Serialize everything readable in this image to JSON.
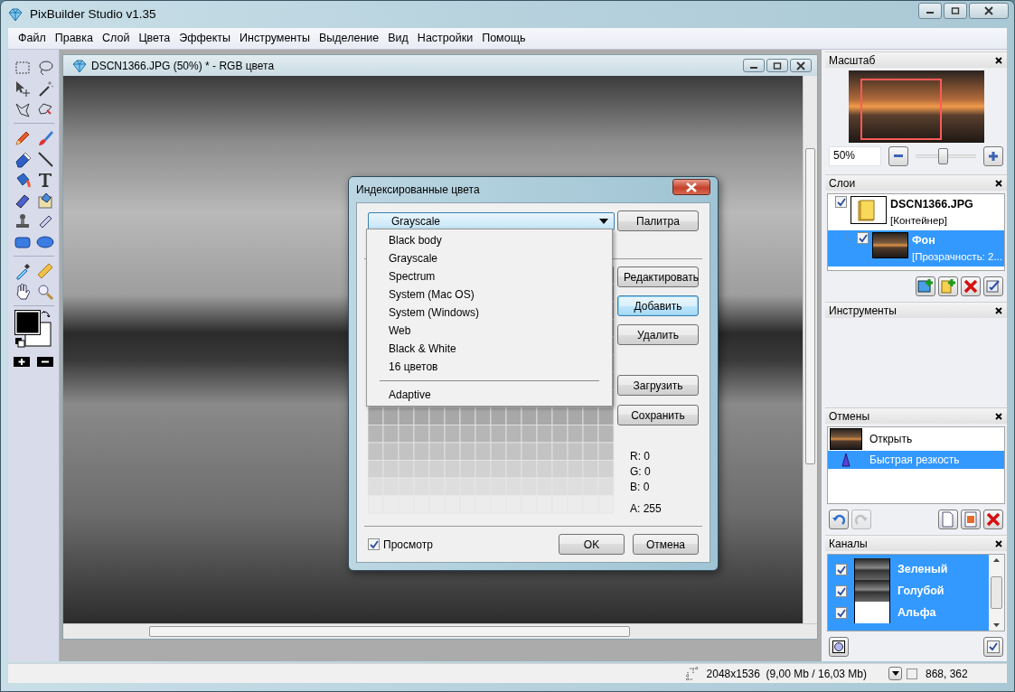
{
  "window": {
    "title": "PixBuilder Studio v1.35"
  },
  "menu": [
    "Файл",
    "Правка",
    "Слой",
    "Цвета",
    "Эффекты",
    "Инструменты",
    "Выделение",
    "Вид",
    "Настройки",
    "Помощь"
  ],
  "document": {
    "title": "DSCN1366.JPG (50%) * - RGB цвета"
  },
  "dialog": {
    "title": "Индексированные цвета",
    "palette_select": {
      "value": "Grayscale",
      "expanded": true,
      "options": [
        {
          "kind": "option",
          "label": "Black body"
        },
        {
          "kind": "option",
          "label": "Grayscale"
        },
        {
          "kind": "option",
          "label": "Spectrum"
        },
        {
          "kind": "option",
          "label": "System (Mac OS)"
        },
        {
          "kind": "option",
          "label": "System (Windows)"
        },
        {
          "kind": "option",
          "label": "Web"
        },
        {
          "kind": "option",
          "label": "Black & White"
        },
        {
          "kind": "option",
          "label": "16 цветов"
        },
        {
          "kind": "separator"
        },
        {
          "kind": "option",
          "label": "Adaptive"
        }
      ]
    },
    "palette_button": {
      "label": "Палитра",
      "focused": false
    },
    "edit_buttons": [
      {
        "label": "Редактировать",
        "focused": false
      },
      {
        "label": "Добавить",
        "focused": true
      },
      {
        "label": "Удалить",
        "focused": false
      }
    ],
    "file_buttons": [
      {
        "label": "Загрузить",
        "focused": false
      },
      {
        "label": "Сохранить",
        "focused": false
      }
    ],
    "readout": [
      {
        "label": "R:",
        "value": "0"
      },
      {
        "label": "G:",
        "value": "0"
      },
      {
        "label": "B:",
        "value": "0"
      },
      {
        "label": "A:",
        "value": "255"
      }
    ],
    "preview": {
      "label": "Просмотр",
      "checked": true
    },
    "footer_buttons": [
      {
        "label": "OK",
        "focused": false
      },
      {
        "label": "Отмена",
        "focused": false
      }
    ]
  },
  "navigator": {
    "title": "Масштаб",
    "zoom": "50%",
    "level": 0.45
  },
  "layers": {
    "title": "Слои",
    "items": [
      {
        "kind": "container",
        "name": "DSCN1366.JPG",
        "info": "[Контейнер]",
        "checked": true,
        "selected": false,
        "children": [
          {
            "kind": "image",
            "name": "Фон",
            "info": "[Прозрачность: 2...",
            "checked": true,
            "selected": true
          }
        ]
      }
    ]
  },
  "tools_panel": {
    "title": "Инструменты"
  },
  "history": {
    "title": "Отмены",
    "items": [
      {
        "kind": "snapshot",
        "label": "Открыть",
        "selected": false
      },
      {
        "kind": "filter",
        "label": "Быстрая резкость",
        "selected": true
      }
    ],
    "redo_disabled": true
  },
  "channels": {
    "title": "Каналы",
    "items": [
      {
        "kind": "image",
        "name": "Зеленый",
        "checked": true,
        "selected": true
      },
      {
        "kind": "image",
        "name": "Голубой",
        "checked": true,
        "selected": true
      },
      {
        "kind": "blank",
        "name": "Альфа",
        "checked": true,
        "selected": true
      }
    ]
  },
  "status_bar": {
    "size": "2048x1536  (9,00 Mb / 16,03 Mb)",
    "coords": "868, 362"
  }
}
